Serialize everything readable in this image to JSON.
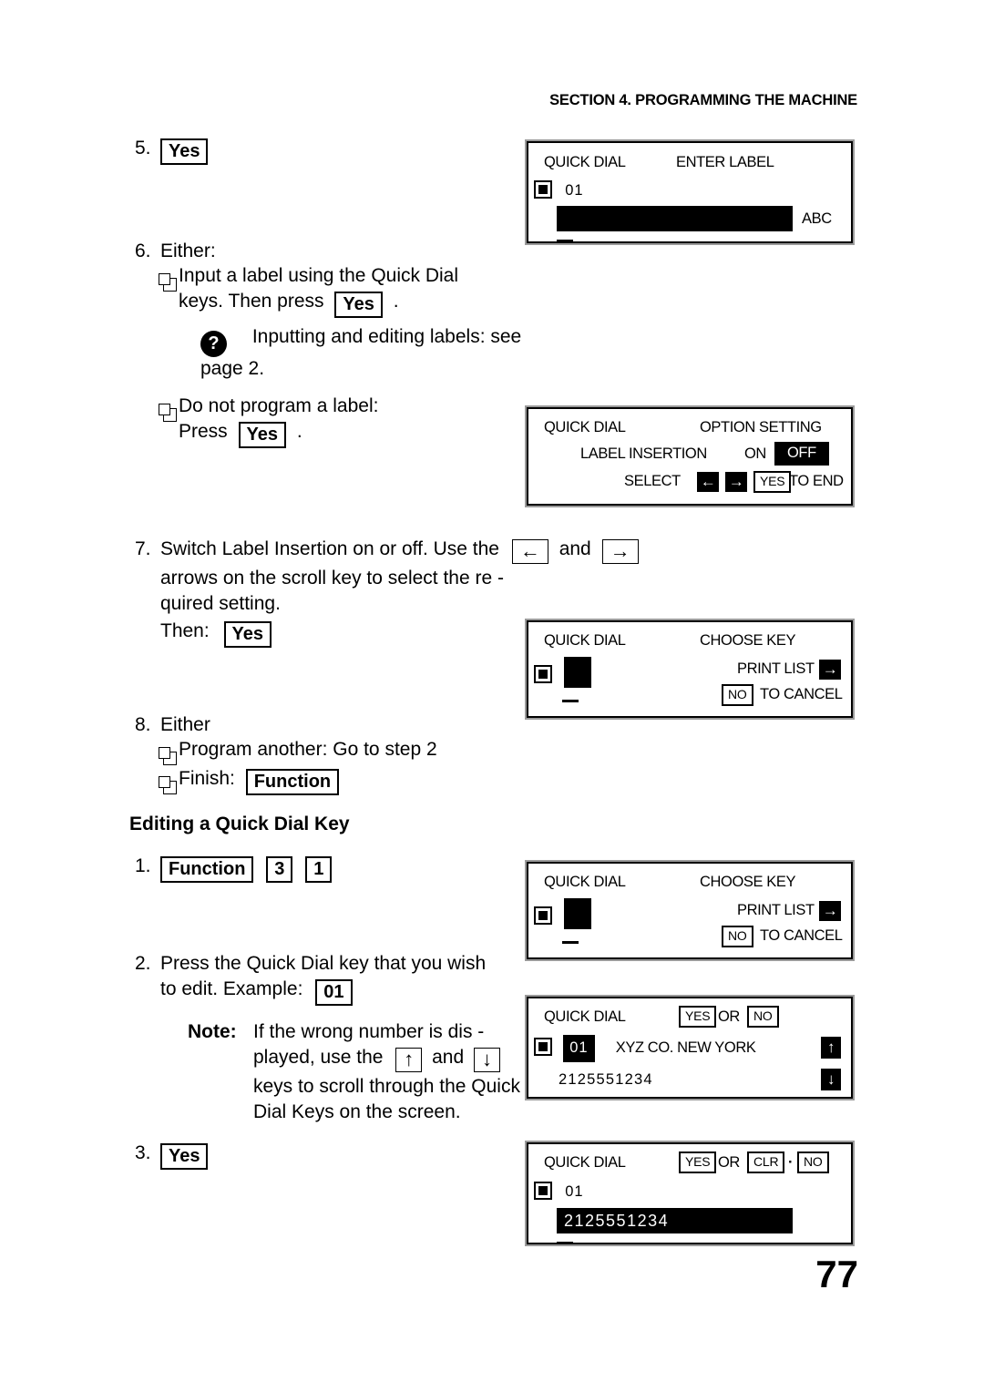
{
  "header": {
    "title": "SECTION 4. PROGRAMMING THE MACHINE"
  },
  "page_number": "77",
  "steps": {
    "s5": {
      "num": "5.",
      "key": "Yes"
    },
    "s6": {
      "num": "6.",
      "title": "Either:",
      "option_a_line1": "Input a label using the Quick Dial",
      "option_a_line2_pre": "keys. Then press",
      "option_a_key": "Yes",
      "option_a_line2_post": ".",
      "help_icon": "?",
      "help_text": "Inputting and editing labels: see page  2.",
      "option_b_line1": "Do not program a label:",
      "option_b_line2_pre": "Press",
      "option_b_key": "Yes",
      "option_b_line2_post": "."
    },
    "s7": {
      "num": "7.",
      "line1_pre": "Switch Label Insertion on or off. Use the",
      "key_left": "←",
      "line1_mid": "and",
      "key_right": "→",
      "line2": "arrows on the scroll key to select the re -",
      "line3": "quired setting.",
      "line4_pre": "Then:",
      "line4_key": "Yes"
    },
    "s8": {
      "num": "8.",
      "title": "Either",
      "option_a": "Program another: Go to step 2",
      "option_b_pre": "Finish:",
      "option_b_key": "Function"
    }
  },
  "editing_section": {
    "heading": "Editing a Quick Dial Key",
    "s1": {
      "num": "1.",
      "key_function": "Function",
      "key_3": "3",
      "key_1": "1"
    },
    "s2": {
      "num": "2.",
      "line1": "Press the Quick Dial key that you wish",
      "line2_pre": "to edit. Example:",
      "line2_key": "01",
      "note_label": "Note:",
      "note_line1": "If the wrong number is dis -",
      "note_line2_pre": "played, use the",
      "note_key_up": "↑",
      "note_line2_mid": "and",
      "note_key_down": "↓",
      "note_line3": "keys to scroll through the Quick",
      "note_line4": "Dial Keys on the screen."
    },
    "s3": {
      "num": "3.",
      "key": "Yes"
    }
  },
  "lcd_panels": {
    "panel1": {
      "title_left": "QUICK DIAL",
      "title_right": "ENTER LABEL",
      "entry_number": "01",
      "mode_indicator": "ABC"
    },
    "panel2": {
      "title_left": "QUICK DIAL",
      "title_right": "OPTION SETTING",
      "option_name": "LABEL INSERTION",
      "option_on": "ON",
      "option_off": "OFF",
      "select_label": "SELECT",
      "arrow_left": "←",
      "arrow_right": "→",
      "yes_key": "YES",
      "to_end": "TO END"
    },
    "panel3": {
      "title_left": "QUICK DIAL",
      "title_right": "CHOOSE KEY",
      "print_list": "PRINT LIST",
      "print_arrow": "→",
      "no_key": "NO",
      "to_cancel": "TO CANCEL"
    },
    "panel4": {
      "title_left": "QUICK DIAL",
      "title_right": "CHOOSE KEY",
      "print_list": "PRINT LIST",
      "print_arrow": "→",
      "no_key": "NO",
      "to_cancel": "TO CANCEL"
    },
    "panel5": {
      "title_left": "QUICK DIAL",
      "yes_key": "YES",
      "or_text": "OR",
      "no_key": "NO",
      "entry_number": "01",
      "entry_label": "XYZ CO. NEW  YORK",
      "entry_number_dialed": "2125551234",
      "scroll_up": "↑",
      "scroll_down": "↓"
    },
    "panel6": {
      "title_left": "QUICK DIAL",
      "yes_key": "YES",
      "or_text": "OR",
      "clr_key": "CLR",
      "dot": "·",
      "no_key": "NO",
      "entry_number": "01",
      "entry_value": "2125551234"
    }
  }
}
